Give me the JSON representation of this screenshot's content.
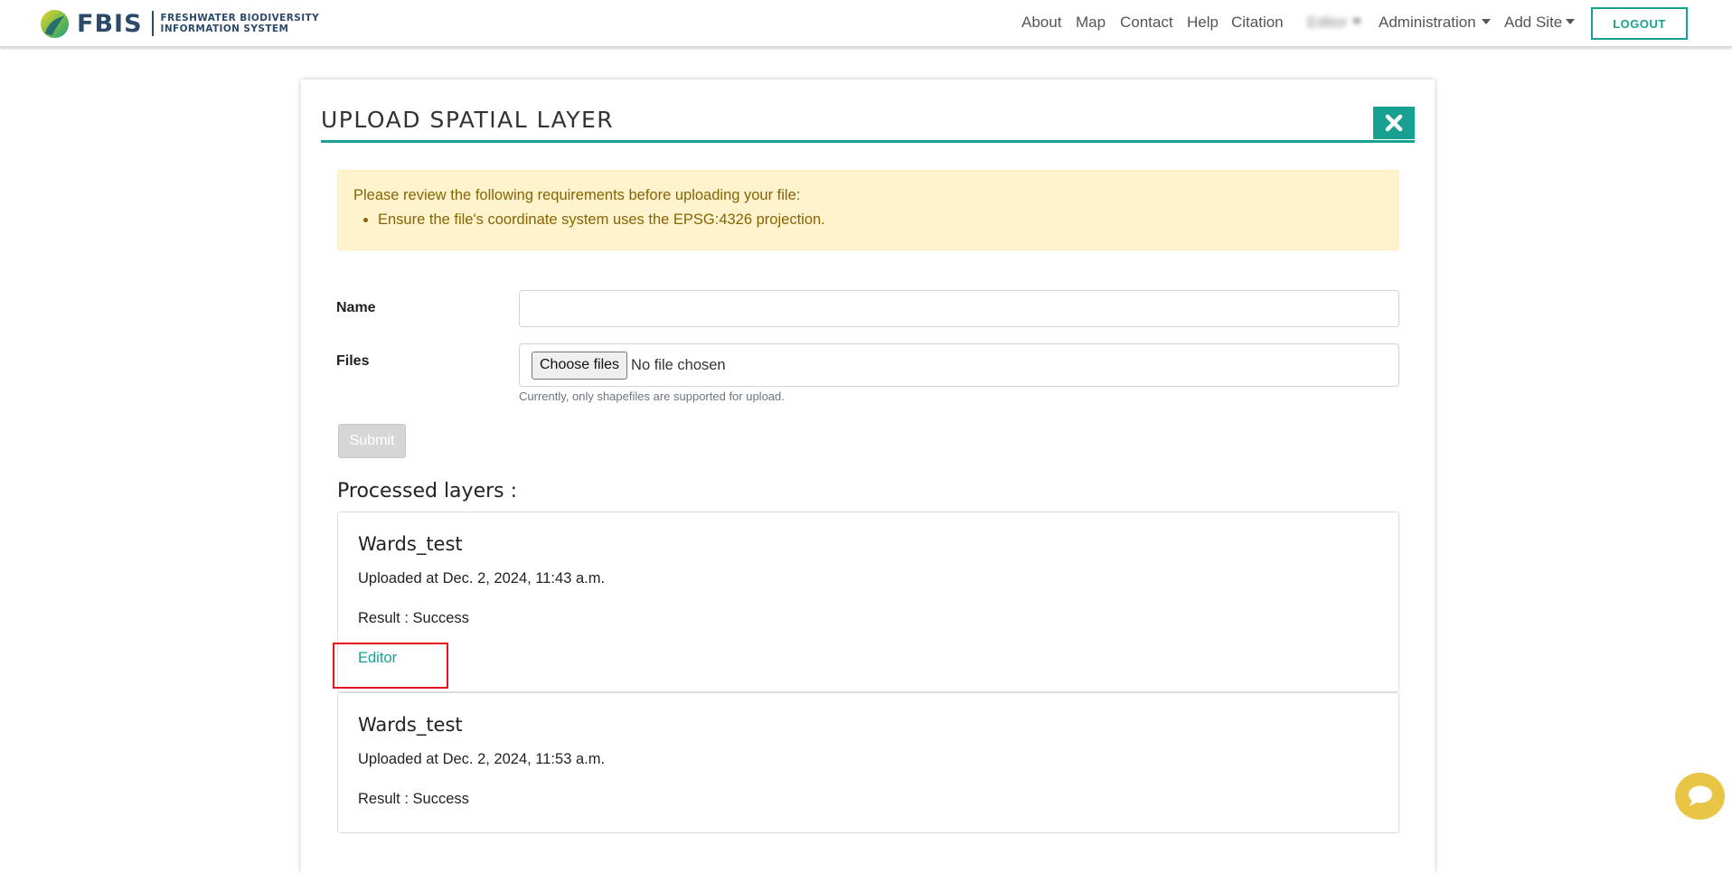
{
  "header": {
    "brand": {
      "name": "FBIS",
      "subtitle_line1": "FRESHWATER BIODIVERSITY",
      "subtitle_line2": "INFORMATION SYSTEM"
    },
    "nav": {
      "about": "About",
      "map": "Map",
      "contact": "Contact",
      "help": "Help",
      "citation": "Citation",
      "user": "Editor",
      "administration": "Administration",
      "add_site": "Add Site"
    },
    "logout_label": "LOGOUT"
  },
  "upload": {
    "title": "UPLOAD SPATIAL LAYER",
    "alert": {
      "intro": "Please review the following requirements before uploading your file:",
      "items": [
        "Ensure the file's coordinate system uses the EPSG:4326 projection."
      ]
    },
    "name_label": "Name",
    "name_value": "",
    "files_label": "Files",
    "choose_files_label": "Choose files",
    "no_file_text": "No file chosen",
    "help_text": "Currently, only shapefiles are supported for upload.",
    "submit_label": "Submit"
  },
  "processed": {
    "heading": "Processed layers :",
    "layers": [
      {
        "name": "Wards_test",
        "uploaded": "Uploaded at Dec. 2, 2024, 11:43 a.m.",
        "result": "Result : Success",
        "link": "Editor"
      },
      {
        "name": "Wards_test",
        "uploaded": "Uploaded at Dec. 2, 2024, 11:53 a.m.",
        "result": "Result : Success"
      }
    ]
  },
  "colors": {
    "accent": "#18a090",
    "brand_text": "#2b4a6a",
    "alert_bg": "#fff3cd",
    "alert_text": "#856404",
    "highlight": "#e8141c",
    "chat": "#e8c545"
  },
  "icons": [
    "fbis-logo-icon",
    "close-icon",
    "chevron-down-icon",
    "chat-bubble-icon"
  ]
}
